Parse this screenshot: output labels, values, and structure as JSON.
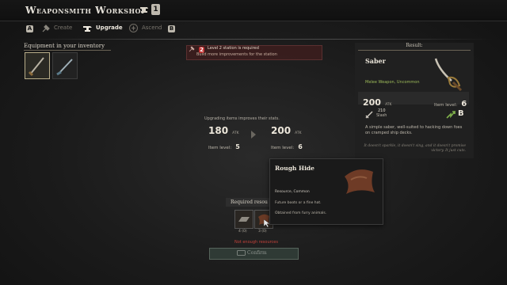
{
  "header": {
    "title": "Weaponsmith Workshop",
    "title_key": "1"
  },
  "tabs": [
    {
      "key": "A",
      "label": "Create",
      "icon": "hammer-icon",
      "active": false
    },
    {
      "key": "",
      "label": "Upgrade",
      "icon": "anvil-icon",
      "active": true
    },
    {
      "key": "",
      "label": "Ascend",
      "icon": "star-icon",
      "active": false
    },
    {
      "key": "B",
      "label": "",
      "icon": "",
      "active": false
    }
  ],
  "inventory": {
    "label": "Equipment in your inventory",
    "items": [
      {
        "icon": "saber-icon",
        "selected": true
      },
      {
        "icon": "blade-icon",
        "selected": false
      }
    ]
  },
  "warning": {
    "level": "2",
    "line1": "Level 2 station is required",
    "line2": "Build more improvements for the station"
  },
  "upgrade": {
    "info": "Upgrading items improves their stats.",
    "current": {
      "atk": "180",
      "unit": "ATK",
      "item_level_label": "Item level:",
      "item_level": "5"
    },
    "next": {
      "atk": "200",
      "unit": "ATK",
      "item_level_label": "Item level:",
      "item_level": "6"
    }
  },
  "result": {
    "heading": "Result:",
    "name": "Saber",
    "type": "Melee Weapon, Uncommon",
    "atk": "200",
    "atk_unit": "ATK",
    "item_level_label": "Item level:",
    "item_level": "6",
    "damage_value": "210",
    "damage_type": "Slash",
    "grade": "B",
    "description": "A simple saber, well-suited to hacking down foes on cramped ship decks.",
    "flavor": "It doesn't sparkle, it doesn't sing, and it doesn't promise victory. It just cuts."
  },
  "tooltip": {
    "name": "Rough Hide",
    "type": "Resource, Common",
    "line1": "Future boots or a fine hat.",
    "line2": "Obtained from furry animals."
  },
  "required": {
    "label": "Required resou",
    "items": [
      {
        "icon": "ingot-icon",
        "count": "4 (0)"
      },
      {
        "icon": "hide-icon",
        "count": "3 (0)"
      }
    ],
    "status": "Not enough resources"
  },
  "confirm_label": "Confirm",
  "colors": {
    "accent_green": "#9dbb5a",
    "warning_red": "#c2423a"
  }
}
